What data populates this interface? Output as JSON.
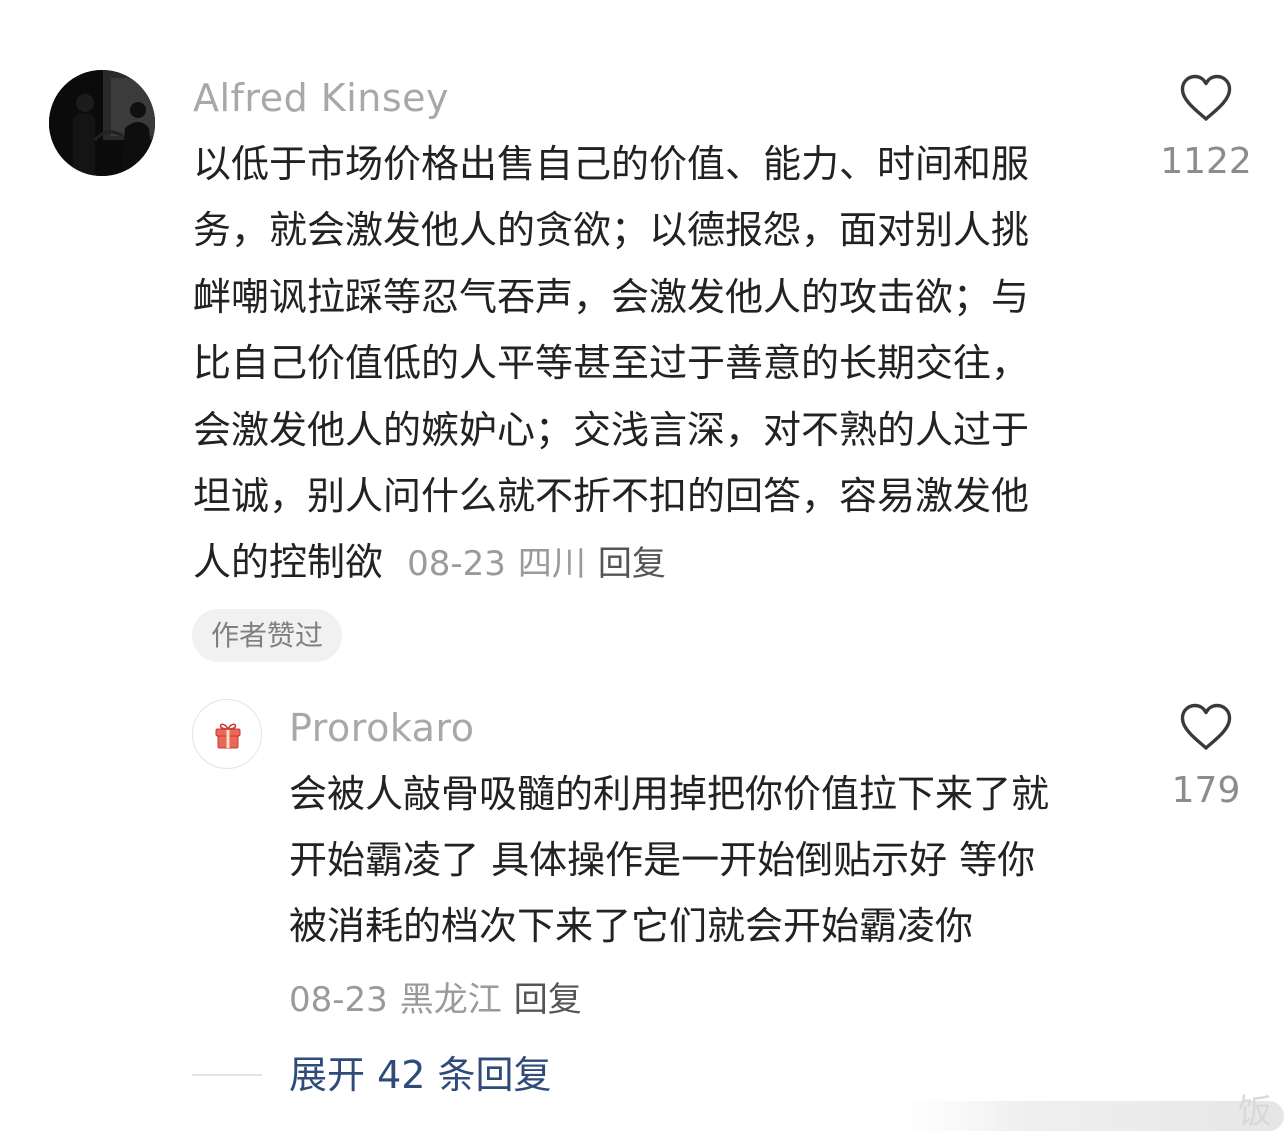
{
  "main_comment": {
    "username": "Alfred Kinsey",
    "text_lines": [
      "以低于市场价格出售自己的价值、能力、时间和服",
      "务，就会激发他人的贪欲；以德报怨，面对别人挑",
      "衅嘲讽拉踩等忍气吞声，会激发他人的攻击欲；与",
      "比自己价值低的人平等甚至过于善意的长期交往，",
      "会激发他人的嫉妒心；交浅言深，对不熟的人过于",
      "坦诚，别人问什么就不折不扣的回答，容易激发他",
      "人的控制欲"
    ],
    "date": "08-23",
    "location": "四川",
    "reply_label": "回复",
    "author_liked_badge": "作者赞过",
    "like_count": "1122",
    "avatar_icon": "person-photo-avatar-icon",
    "like_icon": "heart-outline-icon"
  },
  "reply_comment": {
    "username": "Prorokaro",
    "text_lines": [
      "会被人敲骨吸髓的利用掉把你价值拉下来了就",
      "开始霸凌了 具体操作是一开始倒贴示好 等你",
      "被消耗的档次下来了它们就会开始霸凌你"
    ],
    "date": "08-23",
    "location": "黑龙江",
    "reply_label": "回复",
    "like_count": "179",
    "avatar_icon": "gift-box-avatar-icon",
    "like_icon": "heart-outline-icon"
  },
  "expand_replies": {
    "label": "展开 42 条回复"
  },
  "watermark": {
    "text": "饭"
  },
  "colors": {
    "username": "#a8a8a8",
    "body_text": "#222222",
    "meta_text": "#9a9a9a",
    "link_blue": "#2e4b7a",
    "badge_bg": "#f1f1f1",
    "gift_red": "#d9463b"
  }
}
